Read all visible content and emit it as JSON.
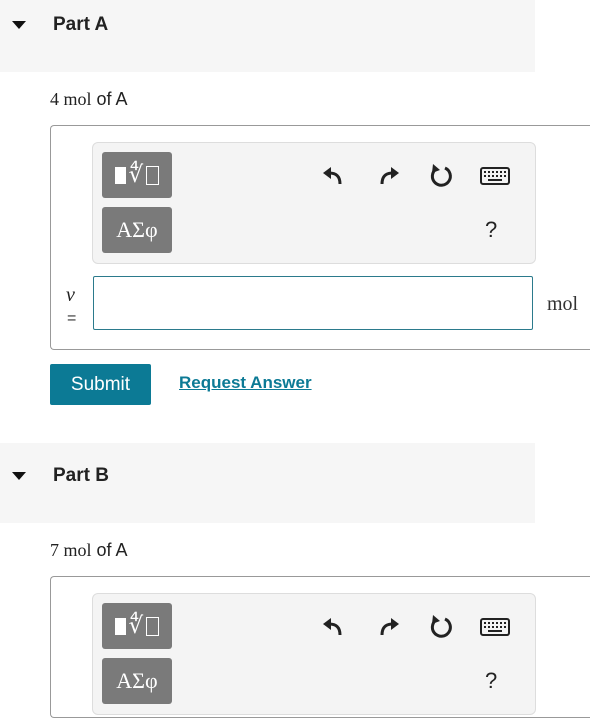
{
  "parts": [
    {
      "title": "Part A",
      "prompt_number": "4 mol",
      "prompt_suffix": " of A",
      "variable": "ν",
      "equals": "=",
      "unit": "mol",
      "input_value": ""
    },
    {
      "title": "Part B",
      "prompt_number": "7 mol",
      "prompt_suffix": " of A"
    }
  ],
  "toolbar": {
    "templates_icon": "fraction-root-template-icon",
    "symbols_label": "ΑΣφ",
    "undo_icon": "undo-icon",
    "redo_icon": "redo-icon",
    "reset_icon": "reset-icon",
    "keyboard_icon": "keyboard-icon",
    "help_label": "?"
  },
  "actions": {
    "submit_label": "Submit",
    "request_answer_label": "Request Answer"
  },
  "colors": {
    "accent": "#0c7a95",
    "toolbar_button": "#7a7a7a",
    "header_bg": "#f6f6f6"
  }
}
